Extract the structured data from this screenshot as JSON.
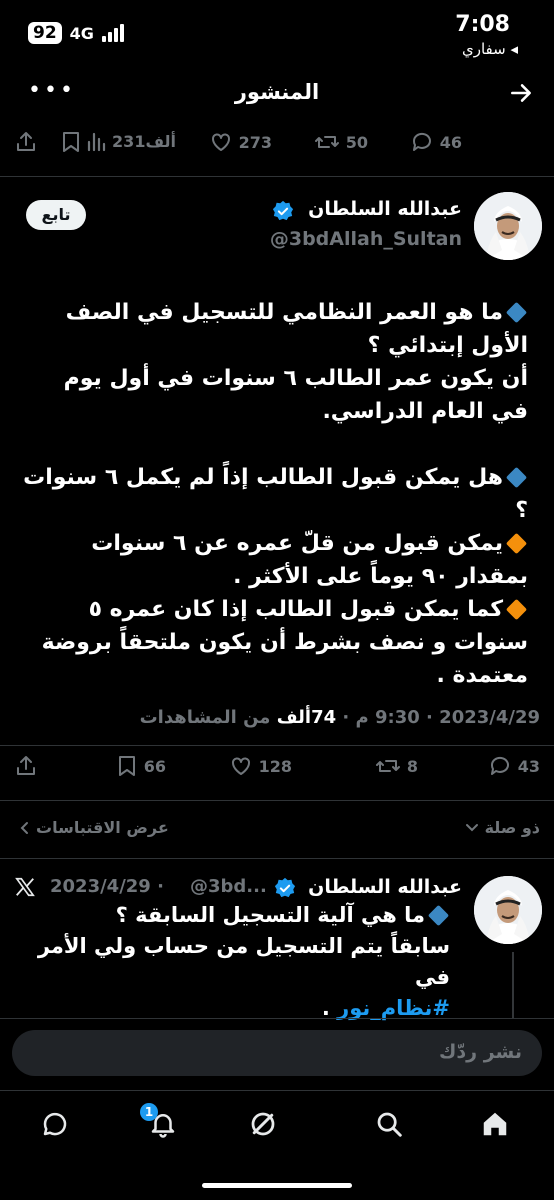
{
  "status": {
    "battery": "92",
    "network": "4G",
    "time": "7:08",
    "back_to_app": "◂ سفاري"
  },
  "header": {
    "title": "المنشور",
    "more_label": "•••"
  },
  "top_actions": {
    "replies": "46",
    "reposts": "50",
    "likes": "273",
    "views": "231ألف"
  },
  "author": {
    "name": "عبدالله السلطان",
    "handle": "@3bdAllah_Sultan",
    "follow_label": "تابع"
  },
  "tweet": {
    "lines": [
      "ما هو العمر النظامي للتسجيل في الصف الأول إبتدائي ؟",
      "أن يكون عمر الطالب ٦ سنوات في أول يوم في العام الدراسي.",
      "هل يمكن قبول الطالب إذاً لم يكمل ٦ سنوات ؟",
      "يمكن قبول من قلّ عمره عن ٦ سنوات بمقدار ٩٠ يوماً على الأكثر .",
      "كما يمكن قبول الطالب إذا كان عمره ٥ سنوات و نصف بشرط أن يكون ملتحقاً بروضة معتمدة ."
    ]
  },
  "meta": {
    "date": "2023/4/29",
    "time": "9:30 م",
    "views_count": "74ألف",
    "views_label": "من المشاهدات"
  },
  "bottom_actions": {
    "replies": "43",
    "reposts": "8",
    "likes": "128",
    "bookmarks": "66"
  },
  "thread": {
    "relevant": "ذو صلة",
    "quotes": "عرض الاقتباسات"
  },
  "reply": {
    "name": "عبدالله السلطان",
    "handle": "@3bd...",
    "date": "2023/4/29 ·",
    "line1": "ما هي آلية التسجيل السابقة ؟",
    "line2": "سابقاً يتم التسجيل من حساب ولي الأمر في",
    "hashtag": "#نظام_نور",
    "tail": " ."
  },
  "composer": {
    "placeholder": "نشر ردّك"
  },
  "nav": {
    "notifications_badge": "1"
  },
  "colors": {
    "accent": "#1d9bf0",
    "muted": "#71767b",
    "background": "#000000"
  }
}
